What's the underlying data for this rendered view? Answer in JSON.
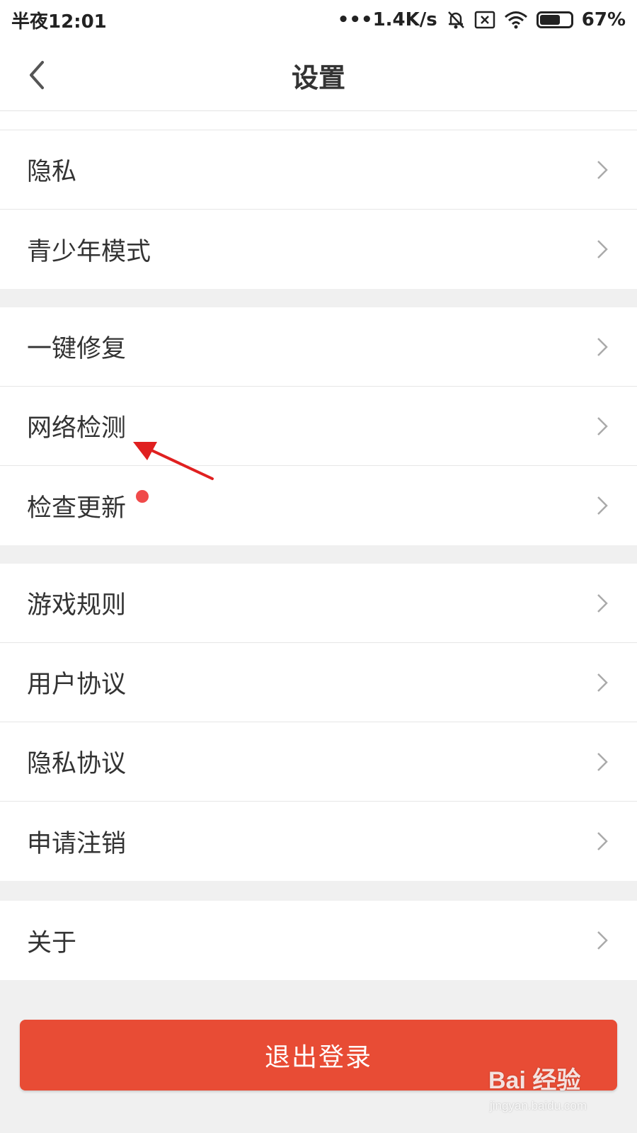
{
  "status_bar": {
    "time": "半夜12:01",
    "network_speed": "•••1.4K/s",
    "battery_percent": "67%",
    "battery_level": 0.67,
    "icons": [
      "bell-off-icon",
      "sim-off-icon",
      "wifi-icon",
      "battery-icon"
    ]
  },
  "nav": {
    "title": "设置",
    "back_icon": "chevron-left-icon"
  },
  "settings": {
    "group1": [
      {
        "label": "隐私"
      },
      {
        "label": "青少年模式"
      }
    ],
    "group2": [
      {
        "label": "一键修复"
      },
      {
        "label": "网络检测"
      },
      {
        "label": "检查更新",
        "badge": "red-dot"
      }
    ],
    "group3": [
      {
        "label": "游戏规则"
      },
      {
        "label": "用户协议"
      },
      {
        "label": "隐私协议"
      },
      {
        "label": "申请注销"
      }
    ],
    "group4": [
      {
        "label": "关于"
      }
    ]
  },
  "logout": {
    "label": "退出登录"
  },
  "watermark": {
    "brand": "Bai 经验",
    "url": "jingyan.baidu.com"
  },
  "colors": {
    "accent": "#e84c35",
    "badge": "#f04a4a",
    "annotation_arrow": "#e02020"
  }
}
